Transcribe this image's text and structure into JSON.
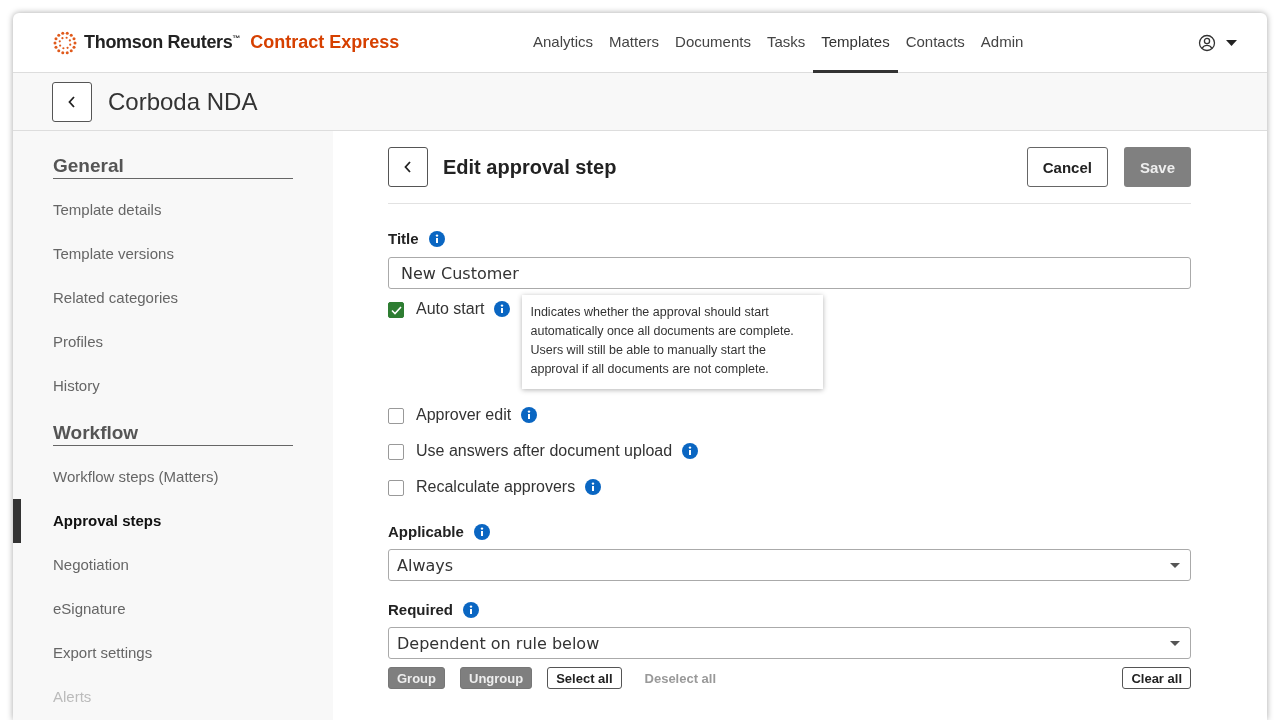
{
  "header": {
    "brand": "Thomson Reuters$^{™}$",
    "product": "Contract Express",
    "nav": [
      {
        "label": "Analytics",
        "selected": false
      },
      {
        "label": "Matters",
        "selected": false
      },
      {
        "label": "Documents",
        "selected": false
      },
      {
        "label": "Tasks",
        "selected": false
      },
      {
        "label": "Templates",
        "selected": true
      },
      {
        "label": "Contacts",
        "selected": false
      },
      {
        "label": "Admin",
        "selected": false
      }
    ]
  },
  "page_title": "Corboda NDA",
  "sidebar": [
    {
      "heading": "General",
      "items": [
        {
          "label": "Template details",
          "selected": false,
          "disabled": false
        },
        {
          "label": "Template versions",
          "selected": false,
          "disabled": false
        },
        {
          "label": "Related categories",
          "selected": false,
          "disabled": false
        },
        {
          "label": "Profiles",
          "selected": false,
          "disabled": false
        },
        {
          "label": "History",
          "selected": false,
          "disabled": false
        }
      ]
    },
    {
      "heading": "Workflow",
      "items": [
        {
          "label": "Workflow steps (Matters)",
          "selected": false,
          "disabled": false
        },
        {
          "label": "Approval steps",
          "selected": true,
          "disabled": false
        },
        {
          "label": "Negotiation",
          "selected": false,
          "disabled": false
        },
        {
          "label": "eSignature",
          "selected": false,
          "disabled": false
        },
        {
          "label": "Export settings",
          "selected": false,
          "disabled": false
        },
        {
          "label": "Alerts",
          "selected": false,
          "disabled": true
        }
      ]
    }
  ],
  "form": {
    "title": "Edit approval step",
    "cancel": "Cancel",
    "save": {
      "label": "Save",
      "disabled": true
    },
    "title_field": {
      "label": "Title",
      "value": "New Customer"
    },
    "options": [
      {
        "label": "Auto start",
        "checked": true,
        "tooltip": "Indicates whether the approval should start automatically once all documents are complete. Users will still be able to manually start the approval if all documents are not complete."
      },
      {
        "label": "Approver edit",
        "checked": false
      },
      {
        "label": "Use answers after document upload",
        "checked": false
      },
      {
        "label": "Recalculate approvers",
        "checked": false
      }
    ],
    "applicable": {
      "label": "Applicable",
      "value": "Always"
    },
    "required": {
      "label": "Required",
      "value": "Dependent on rule below"
    },
    "rule_actions": [
      {
        "label": "Group",
        "kind": "filled"
      },
      {
        "label": "Ungroup",
        "kind": "filled"
      },
      {
        "label": "Select all",
        "kind": "outline"
      },
      {
        "label": "Deselect all",
        "kind": "text"
      },
      {
        "label": "Clear all",
        "kind": "outline-right"
      }
    ]
  }
}
